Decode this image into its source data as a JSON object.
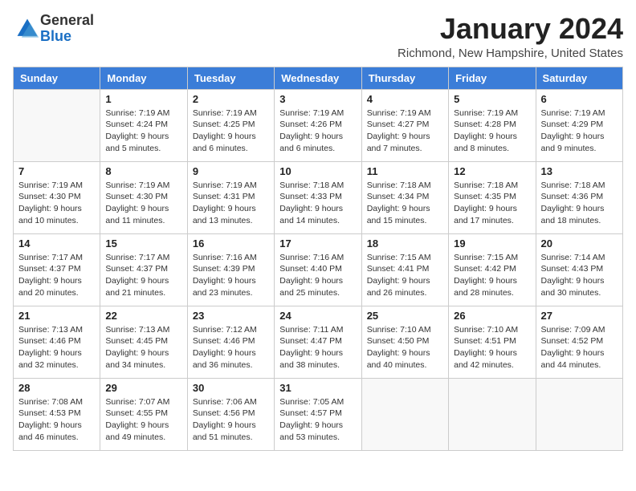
{
  "header": {
    "logo_general": "General",
    "logo_blue": "Blue",
    "month_title": "January 2024",
    "location": "Richmond, New Hampshire, United States"
  },
  "weekdays": [
    "Sunday",
    "Monday",
    "Tuesday",
    "Wednesday",
    "Thursday",
    "Friday",
    "Saturday"
  ],
  "weeks": [
    [
      {
        "day": "",
        "info": ""
      },
      {
        "day": "1",
        "info": "Sunrise: 7:19 AM\nSunset: 4:24 PM\nDaylight: 9 hours\nand 5 minutes."
      },
      {
        "day": "2",
        "info": "Sunrise: 7:19 AM\nSunset: 4:25 PM\nDaylight: 9 hours\nand 6 minutes."
      },
      {
        "day": "3",
        "info": "Sunrise: 7:19 AM\nSunset: 4:26 PM\nDaylight: 9 hours\nand 6 minutes."
      },
      {
        "day": "4",
        "info": "Sunrise: 7:19 AM\nSunset: 4:27 PM\nDaylight: 9 hours\nand 7 minutes."
      },
      {
        "day": "5",
        "info": "Sunrise: 7:19 AM\nSunset: 4:28 PM\nDaylight: 9 hours\nand 8 minutes."
      },
      {
        "day": "6",
        "info": "Sunrise: 7:19 AM\nSunset: 4:29 PM\nDaylight: 9 hours\nand 9 minutes."
      }
    ],
    [
      {
        "day": "7",
        "info": ""
      },
      {
        "day": "8",
        "info": "Sunrise: 7:19 AM\nSunset: 4:30 PM\nDaylight: 9 hours\nand 11 minutes."
      },
      {
        "day": "9",
        "info": "Sunrise: 7:19 AM\nSunset: 4:31 PM\nDaylight: 9 hours\nand 13 minutes."
      },
      {
        "day": "10",
        "info": "Sunrise: 7:18 AM\nSunset: 4:33 PM\nDaylight: 9 hours\nand 14 minutes."
      },
      {
        "day": "11",
        "info": "Sunrise: 7:18 AM\nSunset: 4:34 PM\nDaylight: 9 hours\nand 15 minutes."
      },
      {
        "day": "12",
        "info": "Sunrise: 7:18 AM\nSunset: 4:35 PM\nDaylight: 9 hours\nand 17 minutes."
      },
      {
        "day": "13",
        "info": "Sunrise: 7:18 AM\nSunset: 4:36 PM\nDaylight: 9 hours\nand 18 minutes."
      }
    ],
    [
      {
        "day": "14",
        "info": ""
      },
      {
        "day": "15",
        "info": "Sunrise: 7:17 AM\nSunset: 4:37 PM\nDaylight: 9 hours\nand 21 minutes."
      },
      {
        "day": "16",
        "info": "Sunrise: 7:16 AM\nSunset: 4:39 PM\nDaylight: 9 hours\nand 23 minutes."
      },
      {
        "day": "17",
        "info": "Sunrise: 7:16 AM\nSunset: 4:40 PM\nDaylight: 9 hours\nand 25 minutes."
      },
      {
        "day": "18",
        "info": "Sunrise: 7:15 AM\nSunset: 4:41 PM\nDaylight: 9 hours\nand 26 minutes."
      },
      {
        "day": "19",
        "info": "Sunrise: 7:15 AM\nSunset: 4:42 PM\nDaylight: 9 hours\nand 28 minutes."
      },
      {
        "day": "20",
        "info": "Sunrise: 7:14 AM\nSunset: 4:43 PM\nDaylight: 9 hours\nand 30 minutes."
      }
    ],
    [
      {
        "day": "21",
        "info": ""
      },
      {
        "day": "22",
        "info": "Sunrise: 7:13 AM\nSunset: 4:45 PM\nDaylight: 9 hours\nand 34 minutes."
      },
      {
        "day": "23",
        "info": "Sunrise: 7:12 AM\nSunset: 4:46 PM\nDaylight: 9 hours\nand 36 minutes."
      },
      {
        "day": "24",
        "info": "Sunrise: 7:11 AM\nSunset: 4:47 PM\nDaylight: 9 hours\nand 38 minutes."
      },
      {
        "day": "25",
        "info": "Sunrise: 7:10 AM\nSunset: 4:50 PM\nDaylight: 9 hours\nand 40 minutes."
      },
      {
        "day": "26",
        "info": "Sunrise: 7:10 AM\nSunset: 4:51 PM\nDaylight: 9 hours\nand 42 minutes."
      },
      {
        "day": "27",
        "info": "Sunrise: 7:09 AM\nSunset: 4:52 PM\nDaylight: 9 hours\nand 44 minutes."
      }
    ],
    [
      {
        "day": "28",
        "info": "Sunrise: 7:08 AM\nSunset: 4:53 PM\nDaylight: 9 hours\nand 46 minutes."
      },
      {
        "day": "29",
        "info": "Sunrise: 7:07 AM\nSunset: 4:55 PM\nDaylight: 9 hours\nand 49 minutes."
      },
      {
        "day": "30",
        "info": "Sunrise: 7:06 AM\nSunset: 4:56 PM\nDaylight: 9 hours\nand 51 minutes."
      },
      {
        "day": "31",
        "info": "Sunrise: 7:05 AM\nSunset: 4:57 PM\nDaylight: 9 hours\nand 53 minutes."
      },
      {
        "day": "",
        "info": ""
      },
      {
        "day": "",
        "info": ""
      },
      {
        "day": "",
        "info": ""
      }
    ]
  ],
  "week1_sunday": "Sunrise: 7:19 AM\nSunset: 4:30 PM\nDaylight: 9 hours\nand 10 minutes.",
  "week2_sunday": "Sunrise: 7:17 AM\nSunset: 4:37 PM\nDaylight: 9 hours\nand 20 minutes.",
  "week3_sunday": "Sunrise: 7:13 AM\nSunset: 4:46 PM\nDaylight: 9 hours\nand 32 minutes."
}
